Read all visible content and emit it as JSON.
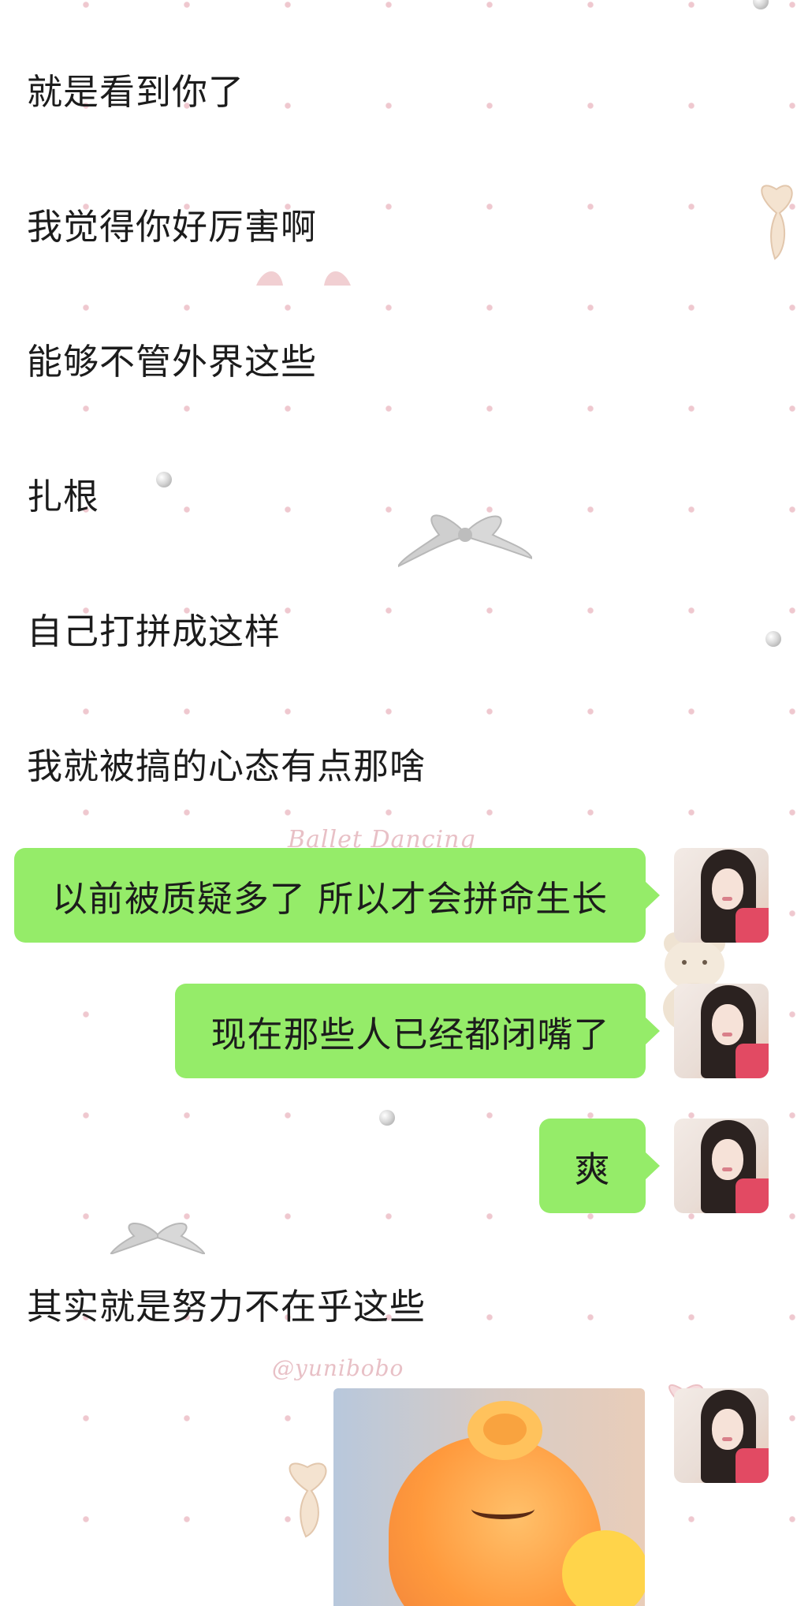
{
  "messages_left": [
    {
      "text": "就是看到你了"
    },
    {
      "text": "我觉得你好厉害啊"
    },
    {
      "text": "能够不管外界这些"
    },
    {
      "text": "扎根"
    },
    {
      "text": "自己打拼成这样"
    },
    {
      "text": "我就被搞的心态有点那啥"
    },
    {
      "text": "其实就是努力不在乎这些"
    }
  ],
  "messages_right": [
    {
      "text": "以前被质疑多了 所以才会拼命生长"
    },
    {
      "text": "现在那些人已经都闭嘴了"
    },
    {
      "text": "爽"
    }
  ],
  "watermarks": {
    "ballet": "Ballet Dancing",
    "handle": "@yunibobo"
  },
  "colors": {
    "bubble_green": "#95ec69",
    "dot_pink": "#efc8cf",
    "text": "#1c1c1c"
  }
}
